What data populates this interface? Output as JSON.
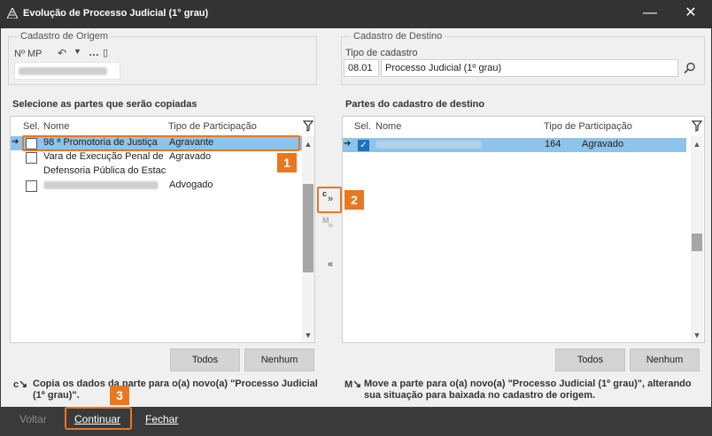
{
  "window": {
    "title": "Evolução de Processo Judicial (1° grau)"
  },
  "origin": {
    "legend": "Cadastro de Origem",
    "nmp_label": "Nº MP",
    "toolbar_icons": [
      "undo-icon",
      "chevron-down-icon",
      "ellipsis-icon",
      "new-document-icon"
    ]
  },
  "destination": {
    "legend": "Cadastro de Destino",
    "type_label": "Tipo de cadastro",
    "type_code": "08.01",
    "type_name": "Processo Judicial (1º grau)"
  },
  "left_grid": {
    "title": "Selecione as partes que serão copiadas",
    "columns": {
      "sel": "Sel.",
      "name": "Nome",
      "type": "Tipo de Participação"
    },
    "rows": [
      {
        "name": "98 ª Promotoria de Justiça",
        "type": "Agravante",
        "selected": true,
        "has_checkbox": true
      },
      {
        "name": "Vara de Execução Penal de",
        "type": "Agravado",
        "selected": false,
        "has_checkbox": true
      },
      {
        "name": "Defensoria Pública do Estac",
        "type": "",
        "selected": false,
        "has_checkbox": false
      },
      {
        "name": "",
        "type": "Advogado",
        "selected": false,
        "has_checkbox": true
      }
    ],
    "all_label": "Todos",
    "none_label": "Nenhum"
  },
  "right_grid": {
    "title": "Partes do cadastro de destino",
    "columns": {
      "sel": "Sel.",
      "name": "Nome",
      "type": "Tipo de Participação"
    },
    "rows": [
      {
        "name": "",
        "code": "164",
        "type": "Agravado",
        "checked": true
      }
    ],
    "all_label": "Todos",
    "none_label": "Nenhum"
  },
  "middle": {
    "copy_glyph": "c",
    "move_glyph": "M",
    "back_glyph": "«"
  },
  "badges": [
    "1",
    "2",
    "3"
  ],
  "hints": {
    "copy": "Copia os dados da parte para o(a) novo(a) \"Processo Judicial (1º grau)\".",
    "move": "Move a parte para o(a) novo(a) \"Processo Judicial (1º grau)\", alterando sua situação para baixada no cadastro de origem."
  },
  "footer": {
    "back": "Voltar",
    "continue": "Continuar",
    "close": "Fechar"
  },
  "colors": {
    "accent": "#e87722",
    "selection": "#8ec3ea",
    "check": "#1e73be"
  }
}
